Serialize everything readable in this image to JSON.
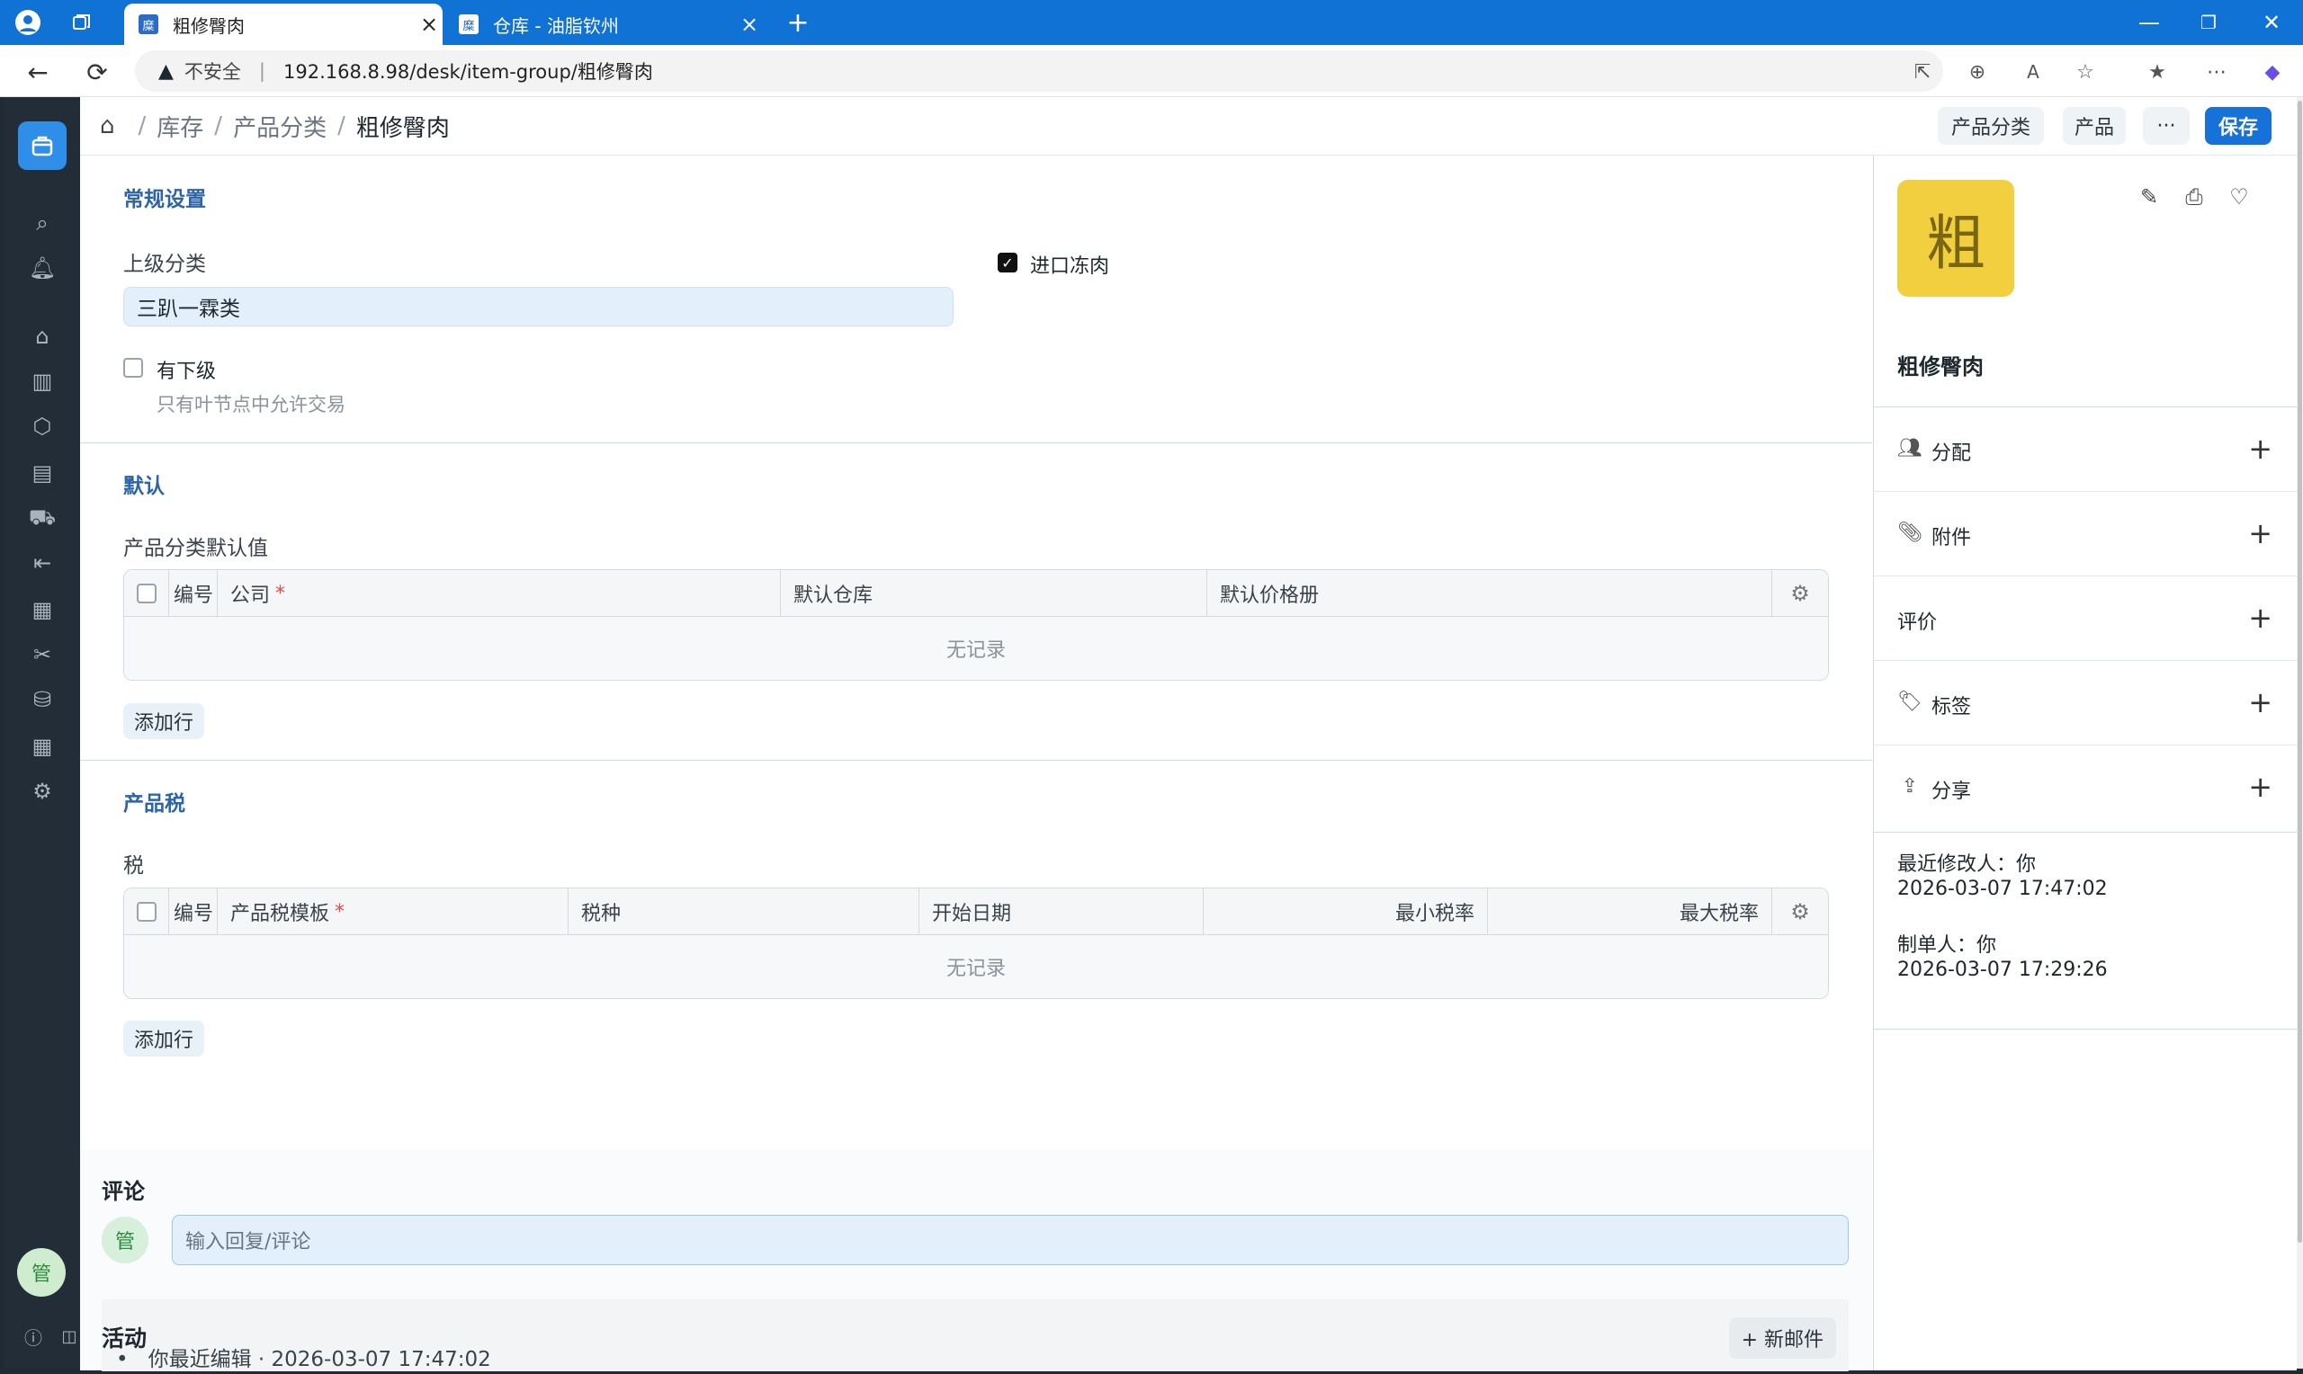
{
  "browser": {
    "tabs": [
      {
        "title": "粗修臀肉",
        "fav": "糜"
      },
      {
        "title": "仓库 - 油脂钦州",
        "fav": "糜"
      }
    ],
    "url_insecure": "不安全",
    "url": "192.168.8.98/desk/item-group/粗修臀肉"
  },
  "app": {
    "breadcrumbs": [
      "库存",
      "产品分类",
      "粗修臀肉"
    ],
    "buttons": {
      "item_group": "产品分类",
      "item": "产品",
      "more": "···",
      "save": "保存"
    },
    "avatar": "管"
  },
  "form": {
    "general": {
      "title": "常规设置",
      "parent_label": "上级分类",
      "parent_value": "三趴一霖类",
      "imported_label": "进口冻肉",
      "imported_checked": true,
      "is_group_label": "有下级",
      "is_group_hint": "只有叶节点中允许交易"
    },
    "defaults": {
      "title": "默认",
      "table_label": "产品分类默认值",
      "columns": [
        "编号",
        "公司",
        "默认仓库",
        "默认价格册"
      ],
      "empty": "无记录",
      "add_row": "添加行"
    },
    "tax": {
      "title": "产品税",
      "table_label": "税",
      "columns": [
        "编号",
        "产品税模板",
        "税种",
        "开始日期",
        "最小税率",
        "最大税率"
      ],
      "empty": "无记录",
      "add_row": "添加行"
    }
  },
  "comments": {
    "title": "评论",
    "avatar": "管",
    "placeholder": "输入回复/评论"
  },
  "activity": {
    "title": "活动",
    "new_email": "+ 新邮件",
    "items": [
      "你最近编辑 · 2026-03-07 17:47:02"
    ]
  },
  "sidebar_panel": {
    "avatar_char": "粗",
    "name": "粗修臀肉",
    "rows": [
      "分配",
      "附件",
      "评价",
      "标签",
      "分享"
    ],
    "modified_label": "最近修改人：你",
    "modified_time": "2026-03-07 17:47:02",
    "created_label": "制单人：你",
    "created_time": "2026-03-07 17:29:26"
  }
}
